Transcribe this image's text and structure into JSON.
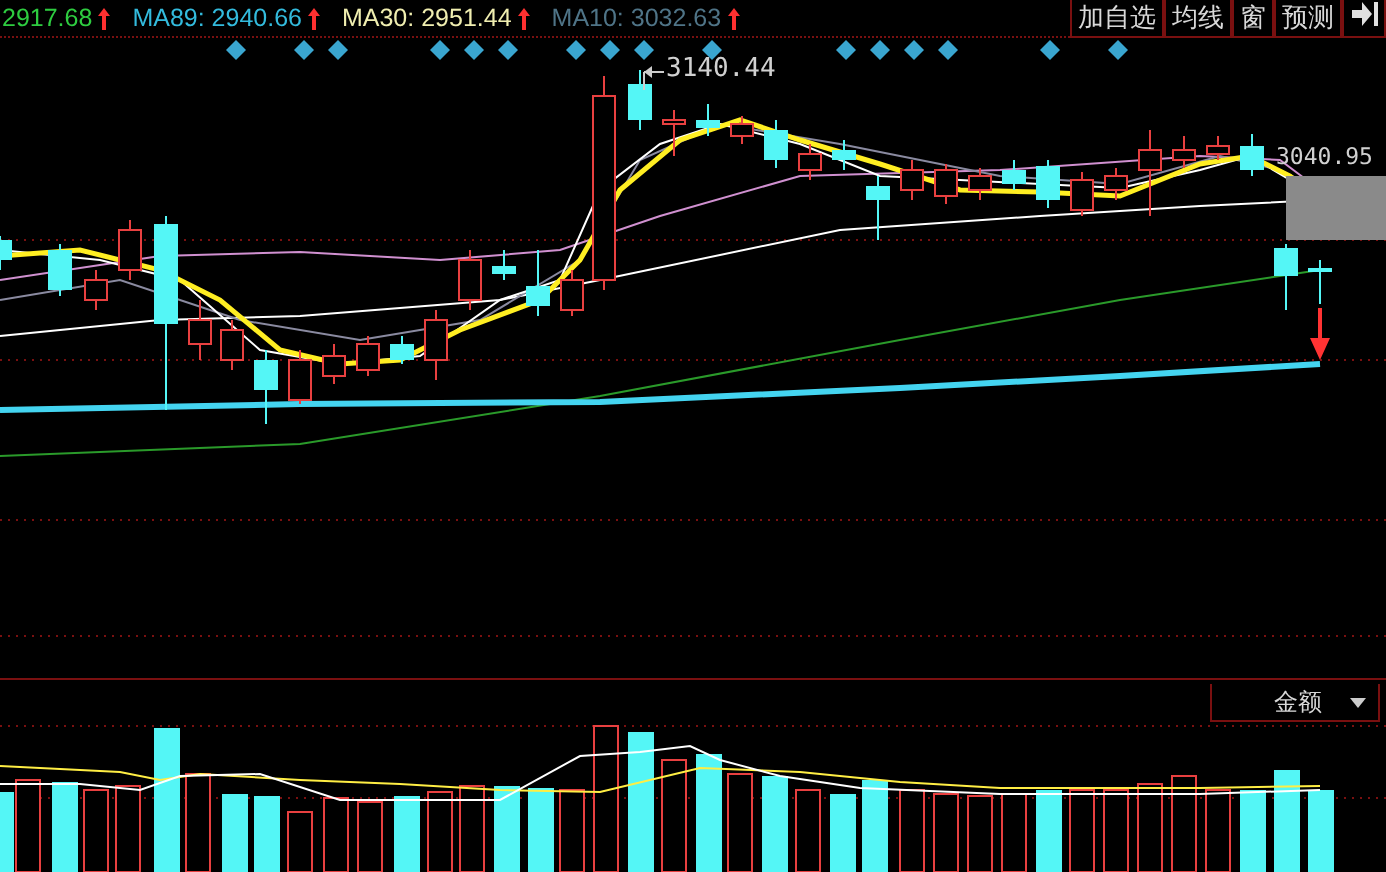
{
  "ma_legend": [
    {
      "label": "2917.68",
      "color": "#2ecc40"
    },
    {
      "label": "MA89: 2940.66",
      "color": "#33bbdd"
    },
    {
      "label": "MA30: 2951.44",
      "color": "#f0eeb0"
    },
    {
      "label": "MA10: 3032.63",
      "color": "#4f7487"
    }
  ],
  "toolbar": {
    "buttons": [
      "加自选",
      "均线",
      "窗",
      "预测"
    ]
  },
  "price_chart": {
    "high_label": "3140.44",
    "last_label": "3040.95"
  },
  "volume_panel": {
    "indicator": "金额"
  }
}
